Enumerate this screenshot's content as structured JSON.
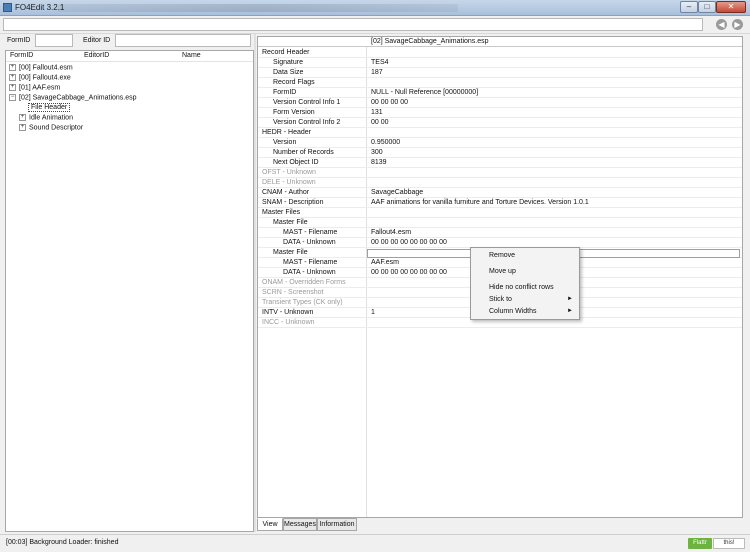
{
  "window": {
    "title": "FO4Edit 3.2.1",
    "icons": {
      "min": "minimize-icon",
      "max": "maximize-icon",
      "close": "close-icon"
    }
  },
  "nav": {
    "back": "◀",
    "forward": "▶"
  },
  "filters": {
    "formid_label": "FormID",
    "editorid_label": "Editor ID"
  },
  "tree": {
    "columns": [
      "FormID",
      "EditorID",
      "Name"
    ],
    "items": [
      {
        "label": "[00] Fallout4.esm",
        "expander": "+"
      },
      {
        "label": "[00] Fallout4.exe",
        "expander": "+"
      },
      {
        "label": "[01] AAF.esm",
        "expander": "+"
      },
      {
        "label": "[02] SavageCabbage_Animations.esp",
        "expander": "−"
      },
      {
        "label": "File Header",
        "expander": ""
      },
      {
        "label": "Idle Animation",
        "expander": "+"
      },
      {
        "label": "Sound Descriptor",
        "expander": "+"
      }
    ]
  },
  "record": {
    "header": "[02] SavageCabbage_Animations.esp",
    "rows": [
      {
        "k": "Record Header",
        "v": ""
      },
      {
        "k": "Signature",
        "v": "TES4"
      },
      {
        "k": "Data Size",
        "v": "187"
      },
      {
        "k": "Record Flags",
        "v": ""
      },
      {
        "k": "FormID",
        "v": "NULL - Null Reference [00000000]"
      },
      {
        "k": "Version Control Info 1",
        "v": "00 00 00 00"
      },
      {
        "k": "Form Version",
        "v": "131"
      },
      {
        "k": "Version Control Info 2",
        "v": "00 00"
      },
      {
        "k": "HEDR - Header",
        "v": ""
      },
      {
        "k": "Version",
        "v": "0.950000"
      },
      {
        "k": "Number of Records",
        "v": "300"
      },
      {
        "k": "Next Object ID",
        "v": "8139"
      },
      {
        "k": "OFST - Unknown",
        "v": ""
      },
      {
        "k": "DELE - Unknown",
        "v": ""
      },
      {
        "k": "CNAM - Author",
        "v": "SavageCabbage"
      },
      {
        "k": "SNAM - Description",
        "v": "AAF animations for vanilla furniture and Torture Devices. Version 1.0.1"
      },
      {
        "k": "Master Files",
        "v": ""
      },
      {
        "k": "Master File",
        "v": ""
      },
      {
        "k": "MAST - Filename",
        "v": "Fallout4.esm"
      },
      {
        "k": "DATA - Unknown",
        "v": "00 00 00 00 00 00 00 00"
      },
      {
        "k": "Master File",
        "v": ""
      },
      {
        "k": "MAST - Filename",
        "v": "AAF.esm"
      },
      {
        "k": "DATA - Unknown",
        "v": "00 00 00 00 00 00 00 00"
      },
      {
        "k": "ONAM - Overridden Forms",
        "v": ""
      },
      {
        "k": "SCRN - Screenshot",
        "v": ""
      },
      {
        "k": "Transient Types (CK only)",
        "v": ""
      },
      {
        "k": "INTV - Unknown",
        "v": "1"
      },
      {
        "k": "INCC - Unknown",
        "v": ""
      }
    ]
  },
  "context_menu": {
    "remove": "Remove",
    "move_up": "Move up",
    "hide_no_conflict": "Hide no conflict rows",
    "stick_to": "Stick to",
    "column_widths": "Column Widths",
    "arrow": "►"
  },
  "tabs": [
    "View",
    "Messages",
    "Information"
  ],
  "status": {
    "text": "[00:03] Background Loader: finished",
    "flattr": "Flattr",
    "this": "this!"
  }
}
